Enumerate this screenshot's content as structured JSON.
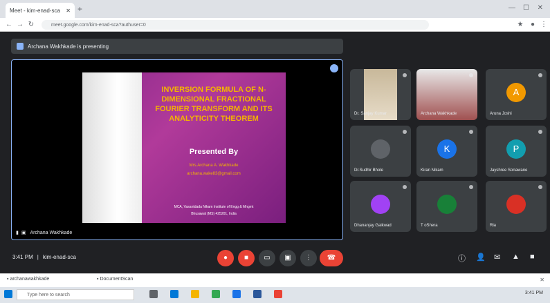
{
  "browser": {
    "tab_title": "Meet - kim-enad-sca",
    "url": "meet.google.com/kim-enad-sca?authuser=0"
  },
  "meet": {
    "presenting_banner": "Archana Wakhkade is presenting",
    "presenter_label": "Archana Wakhkade",
    "slide": {
      "title_lines": [
        "INVERSION FORMULA OF N-",
        "DIMENSIONAL FRACTIONAL",
        "FOURIER TRANSFORM AND ITS",
        "ANALYTICITY THEOREM"
      ],
      "presented_by": "Presented By",
      "author": "Mrs.Archana A. Wakhkade",
      "email": "archana.wake83@gmail.com",
      "affiliation_1": "MCA, Vasantdada Nikam Institute of Engg & Mngmt",
      "affiliation_2": "Bhusawal (MS) 425201, India"
    },
    "participants": [
      {
        "name": "Dr. Sanjay Kumar",
        "avatar": "",
        "color": ""
      },
      {
        "name": "Archana Wakhkade",
        "avatar": "",
        "color": ""
      },
      {
        "name": "Aruna Joshi",
        "avatar": "A",
        "color": "#f29900"
      },
      {
        "name": "Dr.Sudhir Bhole",
        "avatar": "",
        "color": "#5f6368"
      },
      {
        "name": "Kiran Nikam",
        "avatar": "K",
        "color": "#1a73e8"
      },
      {
        "name": "Jayshree Sonawane",
        "avatar": "P",
        "color": "#129eaf"
      },
      {
        "name": "Dhananjay Gaikwad",
        "avatar": "",
        "color": "#a142f4"
      },
      {
        "name": "T oShera",
        "avatar": "",
        "color": "#188038"
      },
      {
        "name": "Ria",
        "avatar": "",
        "color": "#d93025"
      }
    ],
    "time": "3:41 PM",
    "meeting_code": "kim-enad-sca"
  },
  "bottom_bar": {
    "tab_1": "archanawakhkade",
    "tab_2": "DocumentScan"
  },
  "taskbar": {
    "search_placeholder": "Type here to search",
    "clock": "3:41 PM"
  }
}
